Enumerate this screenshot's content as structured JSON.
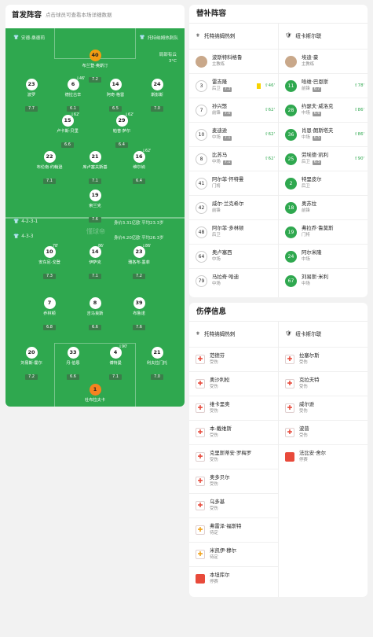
{
  "lineup": {
    "title": "首发阵容",
    "subtitle": "点击球员可查看本场详细数据",
    "home_team": "安德-桑德莉",
    "away_team": "托特纳姆热刺队",
    "weather_1": "局部有云",
    "weather_2": "3°C",
    "away_formation": "4-2-3-1",
    "away_value": "身价3.31亿欧 平均23.3岁",
    "home_formation": "4-3-3",
    "home_value": "身价4.20亿欧 平均26.3岁",
    "watermark": "懂球帝",
    "players": [
      {
        "num": "40",
        "name": "布兰登·奥斯汀",
        "rate": "7.2",
        "gk": true
      },
      {
        "num": "23",
        "name": "波罗",
        "rate": "7.7"
      },
      {
        "num": "6",
        "name": "德拉古辛",
        "rate": "6.1",
        "event": "⇩46'"
      },
      {
        "num": "14",
        "name": "阿奇·格雷",
        "rate": "6.5"
      },
      {
        "num": "24",
        "name": "斯彭斯",
        "rate": "7.0"
      },
      {
        "num": "15",
        "name": "卢卡斯·贝里",
        "rate": "6.6",
        "event": "⇩62'"
      },
      {
        "num": "29",
        "name": "帕普·萨尔",
        "rate": "6.4",
        "event": "⇩62'"
      },
      {
        "num": "22",
        "name": "布伦南·约翰逊",
        "rate": "7.1"
      },
      {
        "num": "21",
        "name": "库卢塞夫斯基",
        "rate": "7.1"
      },
      {
        "num": "16",
        "name": "维尔纳",
        "rate": "6.4",
        "event": "⇩62'"
      },
      {
        "num": "19",
        "name": "索兰克",
        "rate": "7.6"
      },
      {
        "num": "10",
        "name": "安东尼·戈登",
        "rate": "7.3",
        "event": "78'"
      },
      {
        "num": "14",
        "name": "伊萨克",
        "rate": "7.1",
        "event": "86'"
      },
      {
        "num": "23",
        "name": "雅各布·墨菲",
        "rate": "7.2",
        "event": "⇩86'"
      },
      {
        "num": "7",
        "name": "乔林顿",
        "rate": "6.8"
      },
      {
        "num": "8",
        "name": "吉马良斯",
        "rate": "6.6"
      },
      {
        "num": "39",
        "name": "布鲁诺",
        "rate": "7.6"
      },
      {
        "num": "20",
        "name": "刘易斯·霍尔",
        "rate": "7.2"
      },
      {
        "num": "33",
        "name": "丹·伯恩",
        "rate": "6.6"
      },
      {
        "num": "4",
        "name": "博特曼",
        "rate": "7.1",
        "event": "⇩90'"
      },
      {
        "num": "21",
        "name": "利夫拉门托",
        "rate": "7.0"
      },
      {
        "num": "1",
        "name": "杜布拉夫卡",
        "rate": "7.3",
        "gk": true
      }
    ]
  },
  "subs": {
    "title": "替补阵容",
    "team_left": "托特纳姆热刺",
    "team_right": "纽卡斯尔联",
    "coach_left_name": "波斯特科格鲁",
    "coach_left_role": "主教练",
    "coach_right_name": "埃迪·豪",
    "coach_right_role": "主教练",
    "left": [
      {
        "num": "3",
        "name": "雷吉隆",
        "pos": "后卫",
        "rate": "7.3",
        "time": "46'",
        "yc": true,
        "green": false
      },
      {
        "num": "7",
        "name": "孙兴慜",
        "pos": "前锋",
        "rate": "7.0",
        "time": "62'",
        "green": false
      },
      {
        "num": "10",
        "name": "麦迪逊",
        "pos": "中场",
        "rate": "7.1",
        "time": "62'",
        "green": false
      },
      {
        "num": "8",
        "name": "比苏马",
        "pos": "中场",
        "rate": "7.1",
        "time": "62'",
        "green": false
      },
      {
        "num": "41",
        "name": "阿尔菲·怀特曼",
        "pos": "门将",
        "rate": "",
        "time": "",
        "green": false
      },
      {
        "num": "42",
        "name": "威尔·兰克希尔",
        "pos": "前锋",
        "rate": "",
        "time": "",
        "green": false
      },
      {
        "num": "48",
        "name": "阿尔菲·多林顿",
        "pos": "后卫",
        "rate": "",
        "time": "",
        "green": false
      },
      {
        "num": "64",
        "name": "奥卢塞西",
        "pos": "中场",
        "rate": "",
        "time": "",
        "green": false
      },
      {
        "num": "79",
        "name": "马拉奇·哈迪",
        "pos": "中场",
        "rate": "",
        "time": "",
        "green": false
      }
    ],
    "right": [
      {
        "num": "11",
        "name": "哈维·巴恩斯",
        "pos": "前锋",
        "rate": "6.7",
        "time": "78'",
        "green": true
      },
      {
        "num": "28",
        "name": "约瑟夫·威洛克",
        "pos": "中场",
        "rate": "6.6",
        "time": "86'",
        "green": true
      },
      {
        "num": "36",
        "name": "肖恩·朗斯塔夫",
        "pos": "中场",
        "rate": "6.5",
        "time": "86'",
        "green": true
      },
      {
        "num": "25",
        "name": "劳埃德·凯利",
        "pos": "后卫",
        "rate": "6.5",
        "time": "90'",
        "green": true
      },
      {
        "num": "2",
        "name": "特里皮尔",
        "pos": "后卫",
        "rate": "",
        "time": "",
        "green": true
      },
      {
        "num": "18",
        "name": "奥苏拉",
        "pos": "前锋",
        "rate": "",
        "time": "",
        "green": true
      },
      {
        "num": "19",
        "name": "弗拉乔·鲁莫斯",
        "pos": "门将",
        "rate": "",
        "time": "",
        "green": true
      },
      {
        "num": "24",
        "name": "阿尔米隆",
        "pos": "中场",
        "rate": "",
        "time": "",
        "green": true
      },
      {
        "num": "67",
        "name": "刘易斯·米利",
        "pos": "中场",
        "rate": "",
        "time": "",
        "green": true
      }
    ]
  },
  "injuries": {
    "title": "伤停信息",
    "team_left": "托特纳姆热刺",
    "team_right": "纽卡斯尔联",
    "left": [
      {
        "name": "范德芬",
        "status": "受伤",
        "type": "inj"
      },
      {
        "name": "奥沙利松",
        "status": "受伤",
        "type": "inj"
      },
      {
        "name": "维卡里奥",
        "status": "受伤",
        "type": "inj"
      },
      {
        "name": "本-戴维斯",
        "status": "受伤",
        "type": "inj"
      },
      {
        "name": "克里斯蒂安·罗梅罗",
        "status": "受伤",
        "type": "inj"
      },
      {
        "name": "奥多贝尔",
        "status": "受伤",
        "type": "inj"
      },
      {
        "name": "乌多基",
        "status": "受伤",
        "type": "inj"
      },
      {
        "name": "弗雷泽·福斯特",
        "status": "待定",
        "type": "doubt"
      },
      {
        "name": "米凯伊·穆尔",
        "status": "待定",
        "type": "doubt"
      },
      {
        "name": "本坦库尔",
        "status": "停赛",
        "type": "susp"
      }
    ],
    "right": [
      {
        "name": "拉塞尔斯",
        "status": "受伤",
        "type": "inj"
      },
      {
        "name": "克拉夫特",
        "status": "受伤",
        "type": "inj"
      },
      {
        "name": "威尔逊",
        "status": "受伤",
        "type": "inj"
      },
      {
        "name": "波普",
        "status": "受伤",
        "type": "inj"
      },
      {
        "name": "法比安·舍尔",
        "status": "停赛",
        "type": "susp"
      }
    ]
  }
}
